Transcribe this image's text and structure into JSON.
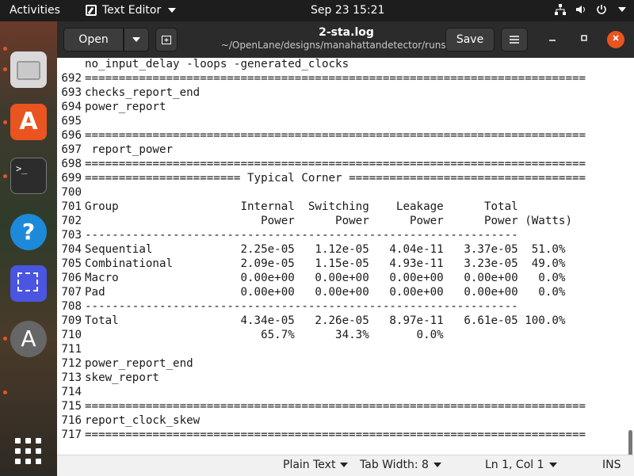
{
  "topbar": {
    "activities": "Activities",
    "app_name": "Text Editor",
    "clock": "Sep 23  15:21"
  },
  "window": {
    "open_label": "Open",
    "save_label": "Save",
    "title": "2-sta.log",
    "subtitle": "~/OpenLane/designs/manahattandetector/runs/RU..."
  },
  "editor": {
    "lines": [
      {
        "num": "",
        "text": "no_input_delay -loops -generated_clocks"
      },
      {
        "num": "692",
        "text": "=========================================================================="
      },
      {
        "num": "693",
        "text": "checks_report_end"
      },
      {
        "num": "694",
        "text": "power_report"
      },
      {
        "num": "695",
        "text": ""
      },
      {
        "num": "696",
        "text": "=========================================================================="
      },
      {
        "num": "697",
        "text": " report_power"
      },
      {
        "num": "698",
        "text": "=========================================================================="
      },
      {
        "num": "699",
        "text": "======================= Typical Corner ==================================="
      },
      {
        "num": "700",
        "text": ""
      },
      {
        "num": "701",
        "text": "Group                  Internal  Switching    Leakage      Total"
      },
      {
        "num": "702",
        "text": "                          Power      Power      Power      Power (Watts)"
      },
      {
        "num": "703",
        "text": "----------------------------------------------------------------"
      },
      {
        "num": "704",
        "text": "Sequential             2.25e-05   1.12e-05   4.04e-11   3.37e-05  51.0%"
      },
      {
        "num": "705",
        "text": "Combinational          2.09e-05   1.15e-05   4.93e-11   3.23e-05  49.0%"
      },
      {
        "num": "706",
        "text": "Macro                  0.00e+00   0.00e+00   0.00e+00   0.00e+00   0.0%"
      },
      {
        "num": "707",
        "text": "Pad                    0.00e+00   0.00e+00   0.00e+00   0.00e+00   0.0%"
      },
      {
        "num": "708",
        "text": "----------------------------------------------------------------"
      },
      {
        "num": "709",
        "text": "Total                  4.34e-05   2.26e-05   8.97e-11   6.61e-05 100.0%"
      },
      {
        "num": "710",
        "text": "                          65.7%      34.3%       0.0%"
      },
      {
        "num": "711",
        "text": ""
      },
      {
        "num": "712",
        "text": "power_report_end"
      },
      {
        "num": "713",
        "text": "skew_report"
      },
      {
        "num": "714",
        "text": ""
      },
      {
        "num": "715",
        "text": "=========================================================================="
      },
      {
        "num": "716",
        "text": "report_clock_skew"
      },
      {
        "num": "717",
        "text": "=========================================================================="
      }
    ]
  },
  "statusbar": {
    "language": "Plain Text",
    "tab_width": "Tab Width: 8",
    "position": "Ln 1, Col 1",
    "mode": "INS"
  },
  "icons": {
    "dock_terminal_prompt": ">_",
    "dock_help": "?",
    "dock_software": "A",
    "dock_updater": "A"
  },
  "colors": {
    "accent": "#e95420",
    "headerbar": "#2b2b2b",
    "topbar": "#1d1d1d"
  }
}
